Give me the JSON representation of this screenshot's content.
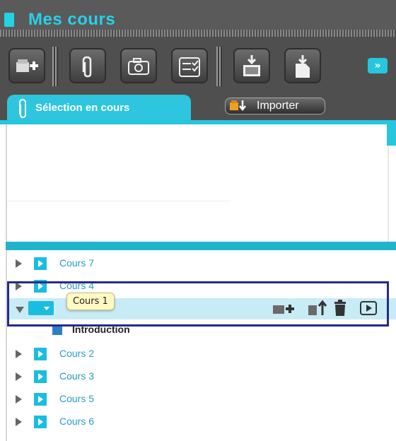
{
  "header": {
    "title": "Mes cours"
  },
  "toolbar": {
    "buttons": [
      {
        "icon": "add-course-icon"
      },
      {
        "icon": "paperclip-icon"
      },
      {
        "icon": "camera-icon"
      },
      {
        "icon": "checklist-icon"
      },
      {
        "icon": "download-image-icon"
      },
      {
        "icon": "download-document-icon"
      }
    ],
    "expand_label": "»"
  },
  "tabs": {
    "selection_label": "Sélection en cours",
    "importer_label": "Importer"
  },
  "courses": [
    {
      "label": "Cours 7",
      "expanded": false
    },
    {
      "label": "Cours 4",
      "expanded": false
    },
    {
      "label": "Cours 1",
      "expanded": true,
      "selected": true,
      "children": [
        {
          "label": "Introduction"
        }
      ]
    },
    {
      "label": "Cours 2",
      "expanded": false
    },
    {
      "label": "Cours 3",
      "expanded": false
    },
    {
      "label": "Cours 5",
      "expanded": false
    },
    {
      "label": "Cours 6",
      "expanded": false
    }
  ],
  "tooltip": {
    "text": "Cours 1"
  },
  "colors": {
    "accent": "#26c6dc",
    "header": "#5a5a5a",
    "link": "#2b9ac9",
    "highlight": "#27298a"
  }
}
